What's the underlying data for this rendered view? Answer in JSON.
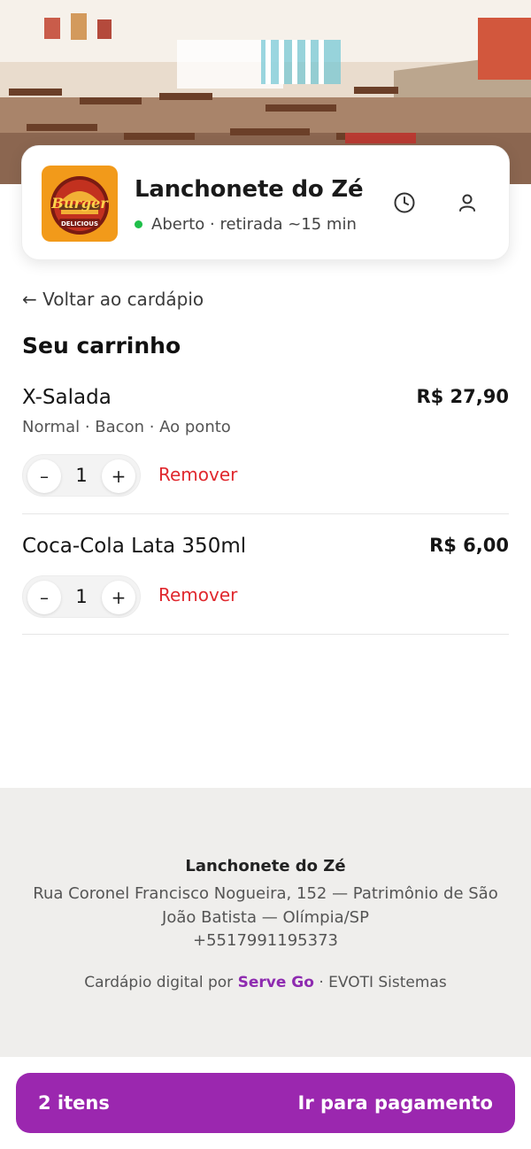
{
  "store": {
    "name": "Lanchonete do Zé",
    "status": "Aberto · retirada ~15 min",
    "logo_text_top": "Burger",
    "logo_text_bottom": "DELICIOUS"
  },
  "nav": {
    "back_label": "← Voltar ao cardápio"
  },
  "cart": {
    "title": "Seu carrinho",
    "items": [
      {
        "name": "X-Salada",
        "price": "R$ 27,90",
        "options": "Normal · Bacon · Ao ponto",
        "qty": "1",
        "minus": "–",
        "plus": "+",
        "remove": "Remover"
      },
      {
        "name": "Coca-Cola Lata 350ml",
        "price": "R$ 6,00",
        "qty": "1",
        "minus": "–",
        "plus": "+",
        "remove": "Remover"
      }
    ]
  },
  "footer": {
    "name": "Lanchonete do Zé",
    "address": "Rua Coronel Francisco Nogueira, 152 — Patrimônio de São João Batista — Olímpia/SP",
    "phone": "+5517991195373",
    "credit_prefix": "Cardápio digital por",
    "credit_brand": "Serve Go",
    "credit_suffix": "· EVOTI Sistemas"
  },
  "checkout": {
    "count": "2 itens",
    "action": "Ir para pagamento"
  },
  "colors": {
    "accent": "#9b27af",
    "danger": "#e0282e",
    "open": "#1fbf4a",
    "logo_bg": "#f29a1a"
  },
  "icons": {
    "clock": "clock-icon",
    "user": "user-icon"
  }
}
